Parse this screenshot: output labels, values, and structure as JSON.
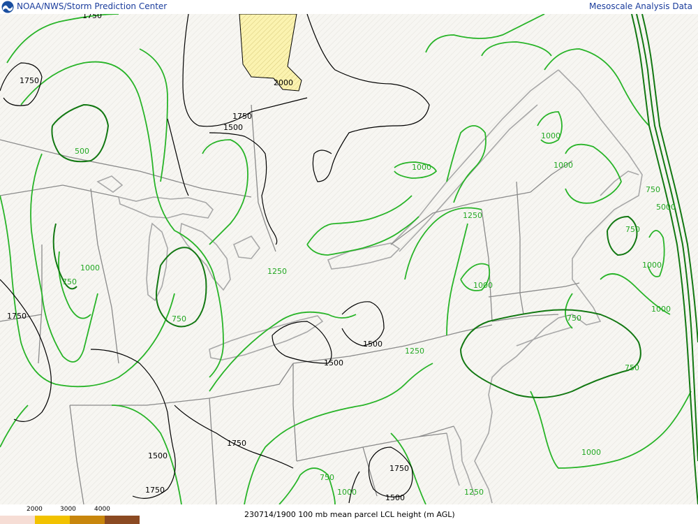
{
  "header": {
    "left_title": "NOAA/NWS/Storm Prediction Center",
    "right_title": "Mesoscale Analysis Data"
  },
  "legend": {
    "items": [
      {
        "label": "",
        "color": "#f6ddd5"
      },
      {
        "label": "2000",
        "color": "#fbe9a8"
      },
      {
        "label": "3000",
        "color": "#f2c200"
      },
      {
        "label": "4000",
        "color": "#c8860d"
      },
      {
        "label": "",
        "color": "#8b4a22"
      }
    ]
  },
  "footer": {
    "caption": "230714/1900 100 mb mean parcel LCL height (m AGL)"
  },
  "map": {
    "colors": {
      "background": "#f7f6f2",
      "hatch": "#e4e2dc",
      "coast": "#a8a8a8",
      "boundary": "#8a8a8a",
      "green_light": "#28b428",
      "green_dark": "#127812",
      "black_contour": "#000000",
      "fill_2000": "#fbf3b0"
    },
    "contour_labels": {
      "l_1750_a": "1750",
      "l_1750_b": "1750",
      "l_1750_c": "1750",
      "l_1750_d": "1750",
      "l_1750_e": "1750",
      "l_1750_f": "1750",
      "l_1750_g": "1750",
      "l_2000": "2000",
      "l_1500_a": "1500",
      "l_1500_b": "1500",
      "l_1500_c": "1500",
      "l_1500_d": "1500",
      "l_1500_e": "1500",
      "l_500": "500",
      "l_1000_a": "1000",
      "l_1000_b": "1000",
      "l_1000_c": "1000",
      "l_1000_d": "1000",
      "l_1000_e": "1000",
      "l_1000_f": "1000",
      "l_1000_g": "1000",
      "l_1000_h": "1000",
      "l_1000_i": "1000",
      "l_1250_a": "1250",
      "l_1250_b": "1250",
      "l_1250_c": "1250",
      "l_1250_d": "1250",
      "l_750_a": "750",
      "l_750_b": "750",
      "l_750_c": "750",
      "l_750_d": "750",
      "l_750_e": "750",
      "l_750_f": "750",
      "l_750_g": "750",
      "l_5000": "5000"
    }
  }
}
